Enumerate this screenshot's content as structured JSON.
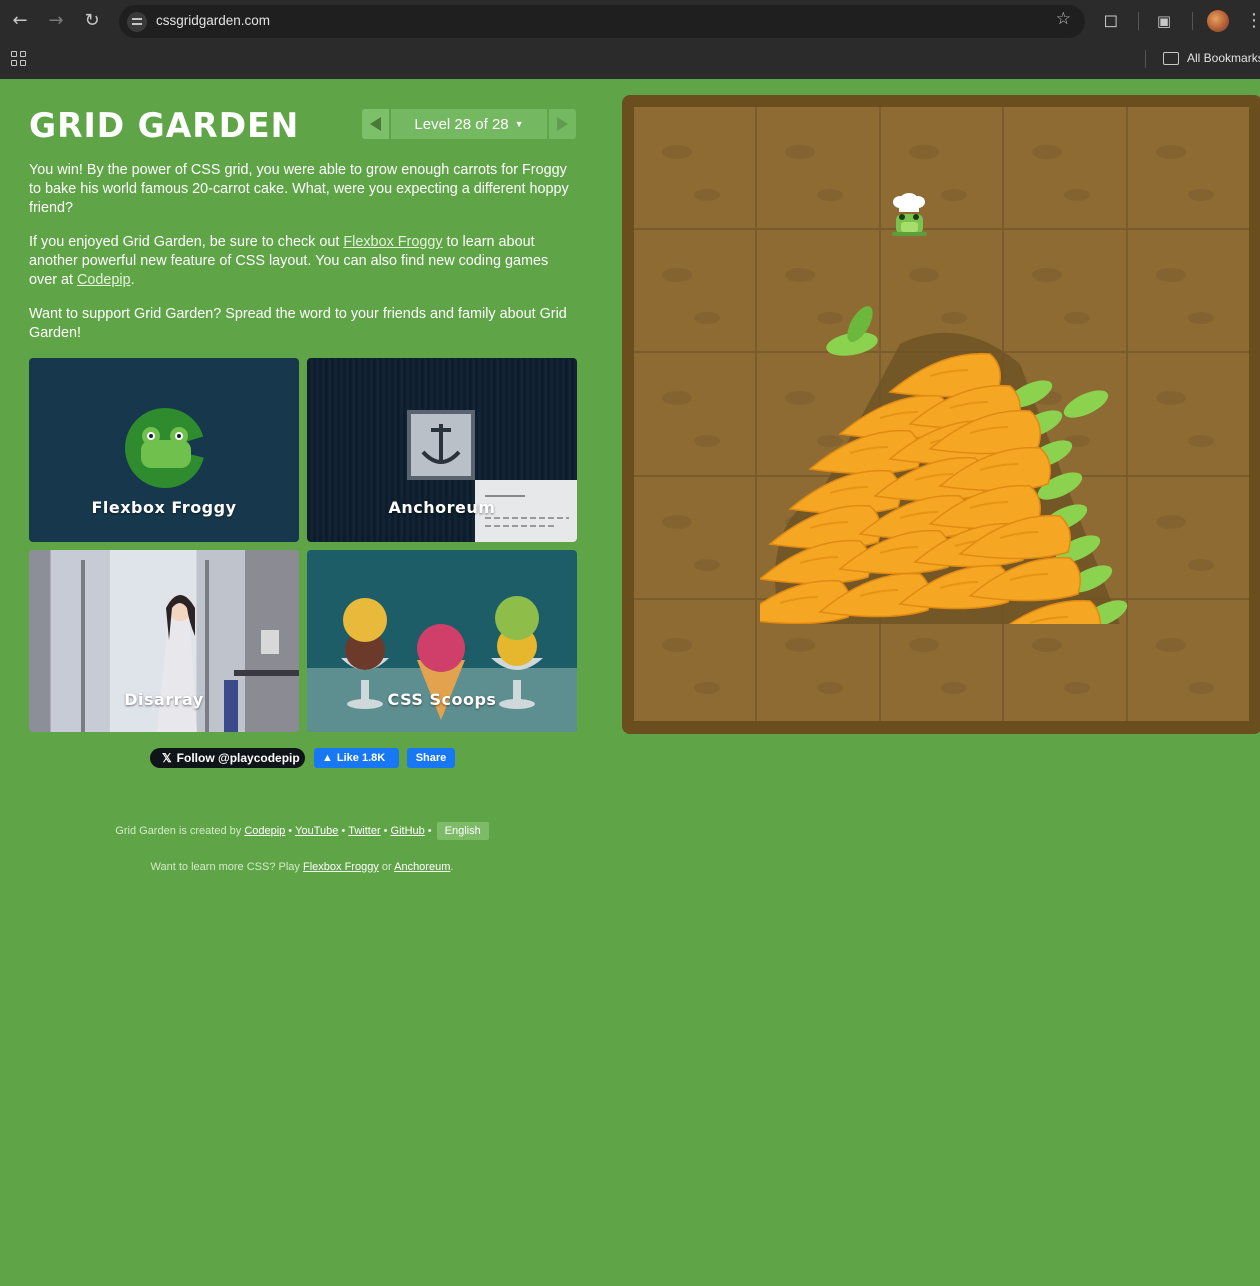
{
  "browser": {
    "url": "cssgridgarden.com",
    "bookmarks_label": "All Bookmarks"
  },
  "header": {
    "logo": "GRID GARDEN",
    "level_label": "Level 28 of 28"
  },
  "instructions": {
    "p1": "You win! By the power of CSS grid, you were able to grow enough carrots for Froggy to bake his world famous 20-carrot cake. What, were you expecting a different hoppy friend?",
    "p2_before": "If you enjoyed Grid Garden, be sure to check out ",
    "p2_link1": "Flexbox Froggy",
    "p2_middle": " to learn about another powerful new feature of CSS layout. You can also find new coding games over at ",
    "p2_link2": "Codepip",
    "p2_after": ".",
    "p3": "Want to support Grid Garden? Spread the word to your friends and family about Grid Garden!"
  },
  "games": [
    {
      "label": "Flexbox Froggy"
    },
    {
      "label": "Anchoreum"
    },
    {
      "label": "Disarray"
    },
    {
      "label": "CSS Scoops"
    }
  ],
  "social": {
    "follow": "Follow @playcodepip",
    "like": "Like 1.8K",
    "share": "Share"
  },
  "footer": {
    "created_by": "Grid Garden is created by",
    "links": [
      "Codepip",
      "YouTube",
      "Twitter",
      "GitHub"
    ],
    "language": "English",
    "learn_more_prefix": "Want to learn more CSS? Play",
    "learn_link1": "Flexbox Froggy",
    "learn_or": "or",
    "learn_link2": "Anchoreum",
    "learn_end": "."
  },
  "colors": {
    "page_background": "#5fa548",
    "soil": "#8d6b33",
    "garden_border": "#6b4e1e",
    "carrot": "#f5a623",
    "carrot_leaf": "#8bd24e"
  },
  "icons": [
    "back-icon",
    "forward-icon",
    "reload-icon",
    "site-info-icon",
    "star-icon",
    "extensions-icon",
    "tab-search-icon",
    "profile-avatar",
    "apps-icon",
    "folder-icon"
  ]
}
